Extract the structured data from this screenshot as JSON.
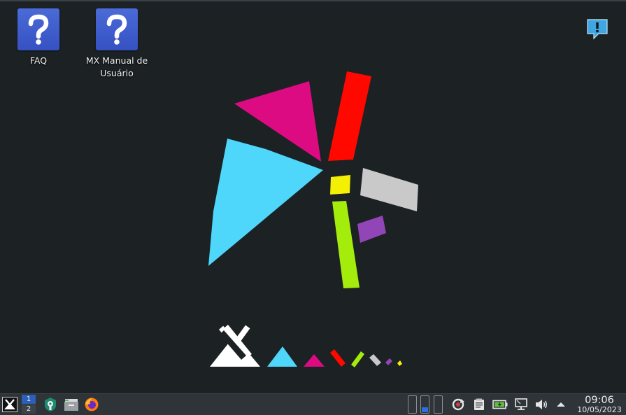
{
  "desktop": {
    "icons": [
      {
        "label": "FAQ",
        "icon": "help-question-icon"
      },
      {
        "label": "MX Manual de\nUsuário",
        "icon": "help-question-icon"
      }
    ],
    "notification_icon": "notification-exclamation-icon",
    "wallpaper": {
      "logo": "mx-linux-logo",
      "colors": {
        "magenta": "#dc0b82",
        "red": "#ff0800",
        "cyan": "#4fd6fb",
        "yellow": "#f3f005",
        "gray": "#c9c9c9",
        "lime": "#a4ec0b",
        "purple": "#9145b6",
        "white": "#ffffff"
      }
    }
  },
  "taskbar": {
    "menu_icon": "mx-menu-icon",
    "workspaces": [
      "1",
      "2"
    ],
    "active_workspace": "1",
    "launchers": [
      "mx-tools-icon",
      "file-manager-icon",
      "firefox-icon"
    ],
    "tray_icons": [
      "update-icon",
      "clipboard-icon",
      "battery-icon",
      "network-icon",
      "volume-icon",
      "expand-tray-icon"
    ],
    "clock": {
      "time": "09:06",
      "date": "10/05/2023"
    },
    "colors": {
      "panel": "#2f3438",
      "active_workspace": "#2c5fb8"
    }
  }
}
